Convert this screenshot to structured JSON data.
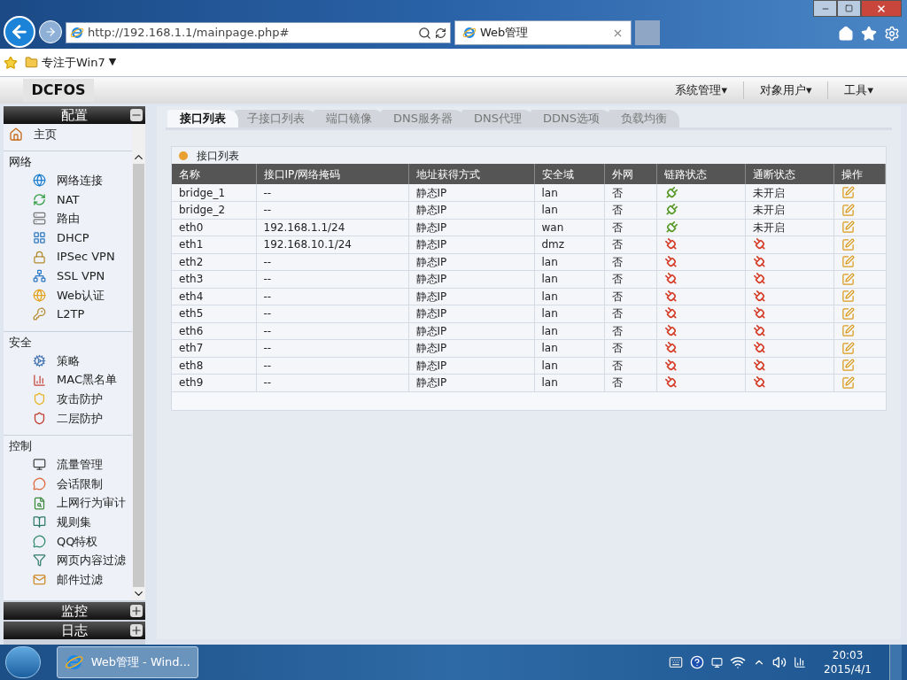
{
  "browser": {
    "url": "http://192.168.1.1/mainpage.php#",
    "tab_title": "Web管理",
    "favorites": [
      {
        "label": "专注于Win7",
        "caret": "▼"
      }
    ]
  },
  "app": {
    "logo": "DCFOS",
    "menus": [
      "系统管理▾",
      "对象用户▾",
      "工具▾"
    ]
  },
  "sidebar": {
    "title": "配置",
    "home": "主页",
    "groups": [
      {
        "title": "网络",
        "items": [
          {
            "label": "网络连接"
          },
          {
            "label": "NAT"
          },
          {
            "label": "路由"
          },
          {
            "label": "DHCP"
          },
          {
            "label": "IPSec VPN"
          },
          {
            "label": "SSL VPN"
          },
          {
            "label": "Web认证"
          },
          {
            "label": "L2TP"
          }
        ]
      },
      {
        "title": "安全",
        "items": [
          {
            "label": "策略"
          },
          {
            "label": "MAC黑名单"
          },
          {
            "label": "攻击防护"
          },
          {
            "label": "二层防护"
          }
        ]
      },
      {
        "title": "控制",
        "items": [
          {
            "label": "流量管理"
          },
          {
            "label": "会话限制"
          },
          {
            "label": "上网行为审计"
          },
          {
            "label": "规则集"
          },
          {
            "label": "QQ特权"
          },
          {
            "label": "网页内容过滤"
          },
          {
            "label": "邮件过滤"
          }
        ]
      }
    ],
    "sections": [
      {
        "title": "监控"
      },
      {
        "title": "日志"
      }
    ]
  },
  "tabs": [
    {
      "label": "接口列表",
      "selected": true
    },
    {
      "label": "子接口列表",
      "selected": false
    },
    {
      "label": "端口镜像",
      "selected": false
    },
    {
      "label": "DNS服务器",
      "selected": false
    },
    {
      "label": "DNS代理",
      "selected": false
    },
    {
      "label": "DDNS选项",
      "selected": false
    },
    {
      "label": "负载均衡",
      "selected": false
    }
  ],
  "table": {
    "title": "接口列表",
    "columns": [
      "名称",
      "接口IP/网络掩码",
      "地址获得方式",
      "安全域",
      "外网",
      "链路状态",
      "通断状态",
      "操作"
    ],
    "rows": [
      {
        "name": "bridge_1",
        "ip": "--",
        "method": "静态IP",
        "zone": "lan",
        "wan": "否",
        "link_up": true,
        "status": {
          "kind": "text",
          "text": "未开启"
        }
      },
      {
        "name": "bridge_2",
        "ip": "--",
        "method": "静态IP",
        "zone": "lan",
        "wan": "否",
        "link_up": true,
        "status": {
          "kind": "text",
          "text": "未开启"
        }
      },
      {
        "name": "eth0",
        "ip": "192.168.1.1/24",
        "method": "静态IP",
        "zone": "wan",
        "wan": "否",
        "link_up": true,
        "status": {
          "kind": "text",
          "text": "未开启"
        }
      },
      {
        "name": "eth1",
        "ip": "192.168.10.1/24",
        "method": "静态IP",
        "zone": "dmz",
        "wan": "否",
        "link_up": false,
        "status": {
          "kind": "icon",
          "connected": false
        }
      },
      {
        "name": "eth2",
        "ip": "--",
        "method": "静态IP",
        "zone": "lan",
        "wan": "否",
        "link_up": false,
        "status": {
          "kind": "icon",
          "connected": false
        }
      },
      {
        "name": "eth3",
        "ip": "--",
        "method": "静态IP",
        "zone": "lan",
        "wan": "否",
        "link_up": false,
        "status": {
          "kind": "icon",
          "connected": false
        }
      },
      {
        "name": "eth4",
        "ip": "--",
        "method": "静态IP",
        "zone": "lan",
        "wan": "否",
        "link_up": false,
        "status": {
          "kind": "icon",
          "connected": false
        }
      },
      {
        "name": "eth5",
        "ip": "--",
        "method": "静态IP",
        "zone": "lan",
        "wan": "否",
        "link_up": false,
        "status": {
          "kind": "icon",
          "connected": false
        }
      },
      {
        "name": "eth6",
        "ip": "--",
        "method": "静态IP",
        "zone": "lan",
        "wan": "否",
        "link_up": false,
        "status": {
          "kind": "icon",
          "connected": false
        }
      },
      {
        "name": "eth7",
        "ip": "--",
        "method": "静态IP",
        "zone": "lan",
        "wan": "否",
        "link_up": false,
        "status": {
          "kind": "icon",
          "connected": false
        }
      },
      {
        "name": "eth8",
        "ip": "--",
        "method": "静态IP",
        "zone": "lan",
        "wan": "否",
        "link_up": false,
        "status": {
          "kind": "icon",
          "connected": false
        }
      },
      {
        "name": "eth9",
        "ip": "--",
        "method": "静态IP",
        "zone": "lan",
        "wan": "否",
        "link_up": false,
        "status": {
          "kind": "icon",
          "connected": false
        }
      }
    ]
  },
  "taskbar": {
    "task": "Web管理 - Wind...",
    "time": "20:03",
    "date": "2015/4/1"
  }
}
